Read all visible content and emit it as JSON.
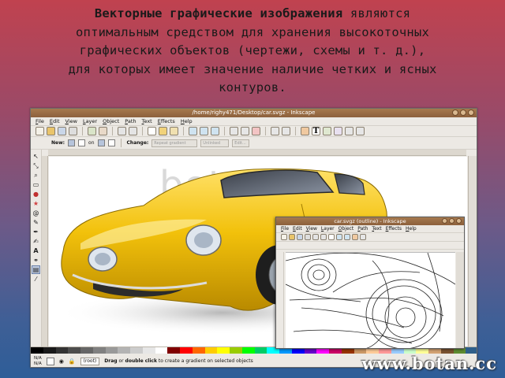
{
  "slide": {
    "heading_bold": "Векторные графические изображения",
    "text_line1_rest": " являются",
    "text_line2": "оптимальным средством для хранения высокоточных",
    "text_line3": "графических объектов (чертежи, схемы и т. д.),",
    "text_line4": "для которых имеет значение наличие четких и ясных",
    "text_line5": "контуров."
  },
  "main_window": {
    "title": "/home/righy471/Desktop/car.svgz - Inkscape",
    "menu": [
      "File",
      "Edit",
      "View",
      "Layer",
      "Object",
      "Path",
      "Text",
      "Effects",
      "Help"
    ],
    "toolbar2": {
      "new_label": "New:",
      "on_label": "on",
      "change_label": "Change:",
      "field1": "Repeat gradient",
      "field2": "Unlinked",
      "field3": "Edit..."
    },
    "canvas_watermark": "botan.cc",
    "status": {
      "na1": "N/A",
      "na2": "N/A",
      "layer": "(root)",
      "msg_bold1": "Drag",
      "msg_mid1": " or ",
      "msg_bold2": "double click",
      "msg_rest": " to create a gradient on selected objects"
    }
  },
  "outline_window": {
    "title": "car.svgz (outline) - Inkscape",
    "menu": [
      "File",
      "Edit",
      "View",
      "Layer",
      "Object",
      "Path",
      "Text",
      "Effects",
      "Help"
    ]
  },
  "footer_watermark": "www.botan.cc",
  "colors": {
    "car_body": "#f2c10b",
    "titlebar": "#8c603c",
    "bg_top": "#c0424f",
    "bg_bottom": "#2e5e98"
  },
  "palette_colors": [
    "#000000",
    "#1a1a1a",
    "#333333",
    "#4d4d4d",
    "#666666",
    "#808080",
    "#999999",
    "#b3b3b3",
    "#cccccc",
    "#e6e6e6",
    "#ffffff",
    "#800000",
    "#ff0000",
    "#ff6600",
    "#ffcc00",
    "#ffff00",
    "#99cc00",
    "#00ff00",
    "#00cc66",
    "#00ffff",
    "#0099ff",
    "#0000ff",
    "#6600cc",
    "#ff00ff",
    "#cc0066",
    "#993300",
    "#cc9966",
    "#ffcc99",
    "#ff9999",
    "#99ccff",
    "#ccffcc",
    "#ffff99",
    "#d4a373",
    "#7a5230",
    "#5e8c31",
    "#2f5f8a"
  ]
}
